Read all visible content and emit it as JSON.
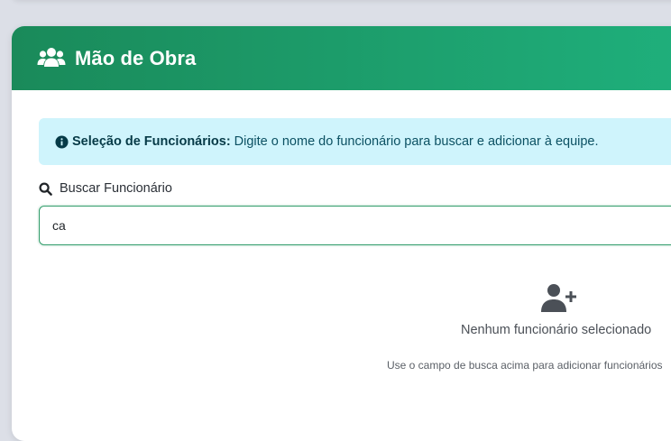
{
  "header": {
    "title": "Mão de Obra",
    "icon": "users-icon"
  },
  "alert": {
    "icon": "info-circle-icon",
    "label": "Seleção de Funcionários:",
    "message": "Digite o nome do funcionário para buscar e adicionar à equipe."
  },
  "search": {
    "icon": "search-icon",
    "label": "Buscar Funcionário",
    "value": "ca"
  },
  "empty_state": {
    "icon": "user-plus-icon",
    "title": "Nenhum funcionário selecionado",
    "hint": "Use o campo de busca acima para adicionar funcionários"
  },
  "colors": {
    "header_start": "#1a8a5a",
    "header_end": "#1fb07c",
    "alert_bg": "#cff4fc",
    "input_border": "#2e9b68"
  }
}
